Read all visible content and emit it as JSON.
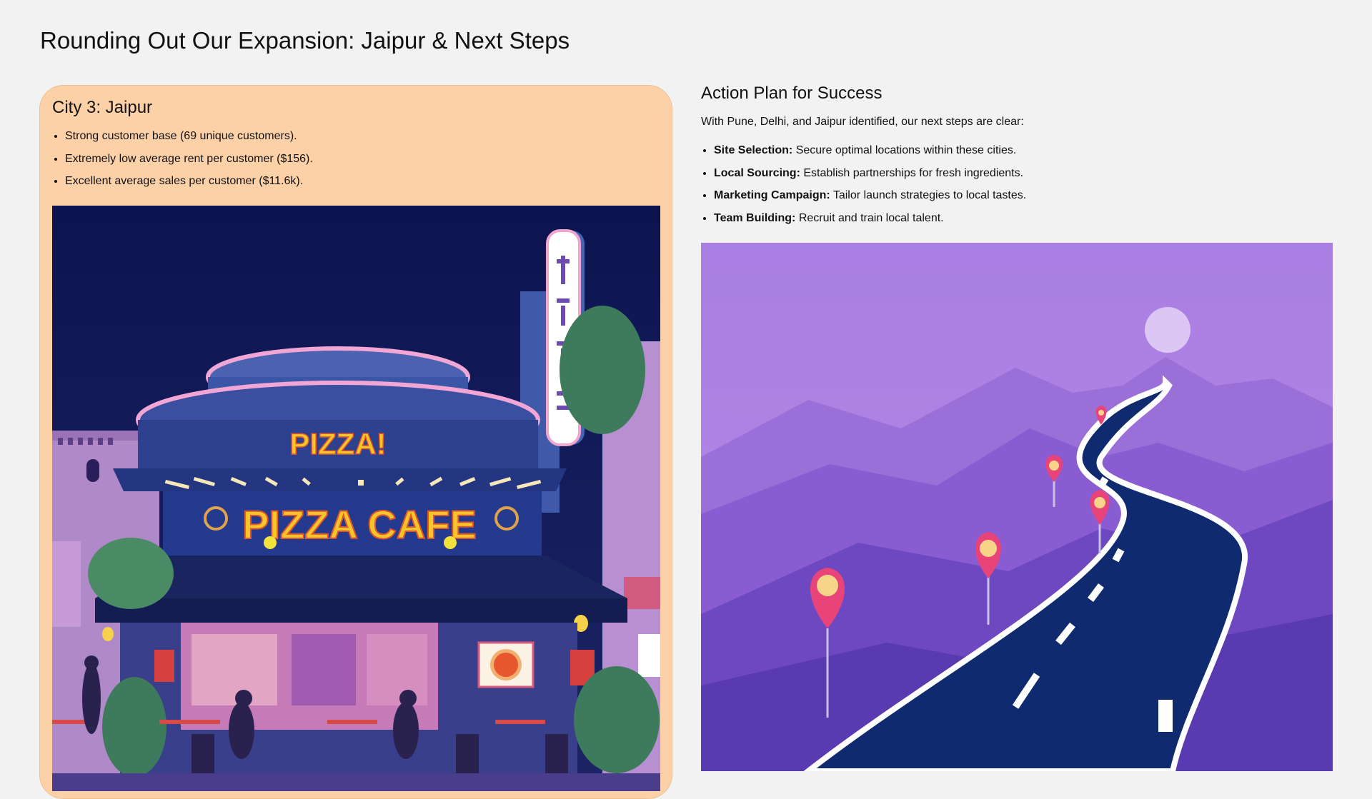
{
  "page": {
    "title": "Rounding Out Our Expansion: Jaipur & Next Steps"
  },
  "city": {
    "heading": "City 3: Jaipur",
    "bullets": [
      "Strong customer base (69 unique customers).",
      "Extremely low average rent per customer ($156).",
      "Excellent average sales per customer ($11.6k)."
    ],
    "illustration": {
      "sign_small": "PIZZA!",
      "sign_main": "PIZZA CAFE"
    }
  },
  "plan": {
    "heading": "Action Plan for Success",
    "intro": "With Pune, Delhi, and Jaipur identified, our next steps are clear:",
    "steps": [
      {
        "label": "Site Selection:",
        "text": "Secure optimal locations within these cities."
      },
      {
        "label": "Local Sourcing:",
        "text": "Establish partnerships for fresh ingredients."
      },
      {
        "label": "Marketing Campaign:",
        "text": "Tailor launch strategies to local tastes."
      },
      {
        "label": "Team Building:",
        "text": "Recruit and train local talent."
      }
    ]
  },
  "colors": {
    "card_bg": "#fdd1a7",
    "night_sky": "#121b58",
    "sign_yellow": "#f5c52b",
    "road": "#0f2a6e",
    "pin": "#e8447a",
    "mountain_purple": "#8a5cd6"
  }
}
